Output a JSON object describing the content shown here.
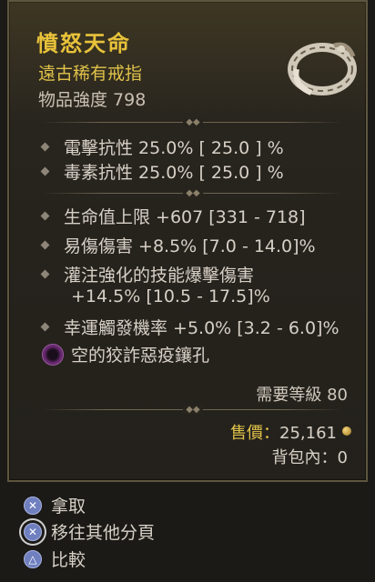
{
  "item": {
    "name": "憤怒天命",
    "rarity": "遠古稀有戒指",
    "power": "物品強度 798"
  },
  "implicit_stats": [
    "電擊抗性 25.0%  [ 25.0 ] %",
    "毒素抗性 25.0%  [ 25.0 ] %"
  ],
  "affixes": [
    "生命值上限 +607 [331 - 718]",
    "易傷傷害 +8.5% [7.0 - 14.0]%",
    "灌注強化的技能爆擊傷害",
    "+14.5% [10.5 - 17.5]%",
    "幸運觸發機率 +5.0% [3.2 - 6.0]%"
  ],
  "socket": "空的狡詐惡疫鑲孔",
  "requirement": "需要等級 80",
  "sell_price_label": "售價：",
  "sell_price_value": "25,161",
  "inventory": "背包內：0",
  "actions": {
    "take": "拿取",
    "move": "移往其他分頁",
    "compare": "比較"
  },
  "colors": {
    "legendary_gold": "#e8c23a",
    "text": "#d7d0c6",
    "background": "#26231d"
  }
}
